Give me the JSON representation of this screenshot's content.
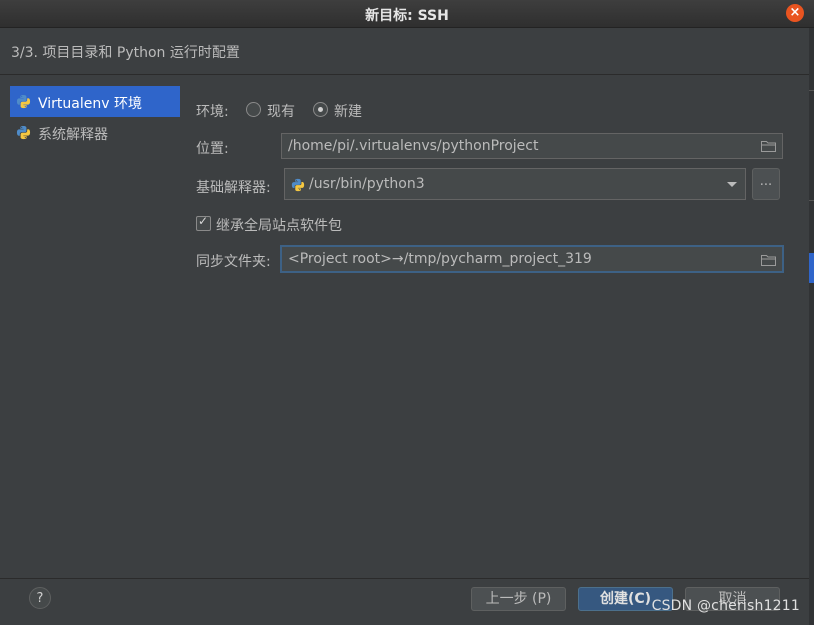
{
  "window": {
    "title": "新目标: SSH",
    "close_icon": "close-icon"
  },
  "header": {
    "step_title": "3/3. 项目目录和 Python 运行时配置"
  },
  "sidebar": {
    "items": [
      {
        "label": "Virtualenv 环境",
        "icon": "python-icon",
        "selected": true
      },
      {
        "label": "系统解释器",
        "icon": "python-icon",
        "selected": false
      }
    ]
  },
  "form": {
    "env_label": "环境:",
    "env_options": {
      "existing": "现有",
      "new": "新建"
    },
    "env_selected": "新建",
    "location_label": "位置:",
    "location_value": "/home/pi/.virtualenvs/pythonProject",
    "base_interp_label": "基础解释器:",
    "base_interp_value": "/usr/bin/python3",
    "browse_label": "...",
    "inherit_label": "继承全局站点软件包",
    "inherit_checked": true,
    "sync_label": "同步文件夹:",
    "sync_value": "<Project root>→/tmp/pycharm_project_319"
  },
  "footer": {
    "help_label": "?",
    "prev_label": "上一步 (P)",
    "create_label": "创建(C)",
    "cancel_label": "取消",
    "watermark": "CSDN @cherish1211"
  },
  "colors": {
    "accent": "#2f65ca",
    "background": "#3c3f41",
    "close": "#e95420"
  }
}
